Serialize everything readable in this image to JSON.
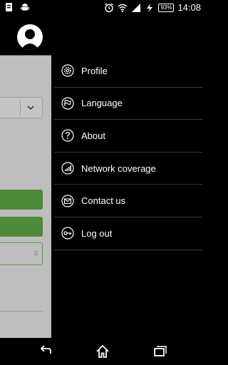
{
  "status_bar": {
    "battery": "93%",
    "time": "14:08"
  },
  "drawer": {
    "menu": [
      {
        "label": "Profile"
      },
      {
        "label": "Language"
      },
      {
        "label": "About"
      },
      {
        "label": "Network coverage"
      },
      {
        "label": "Contact us"
      },
      {
        "label": "Log out"
      }
    ]
  },
  "underlay": {
    "outline_button_text": "s"
  },
  "colors": {
    "accent_green": "#4f8a3a",
    "drawer_bg": "#000000",
    "underlay_bg": "#bdbdbd"
  }
}
